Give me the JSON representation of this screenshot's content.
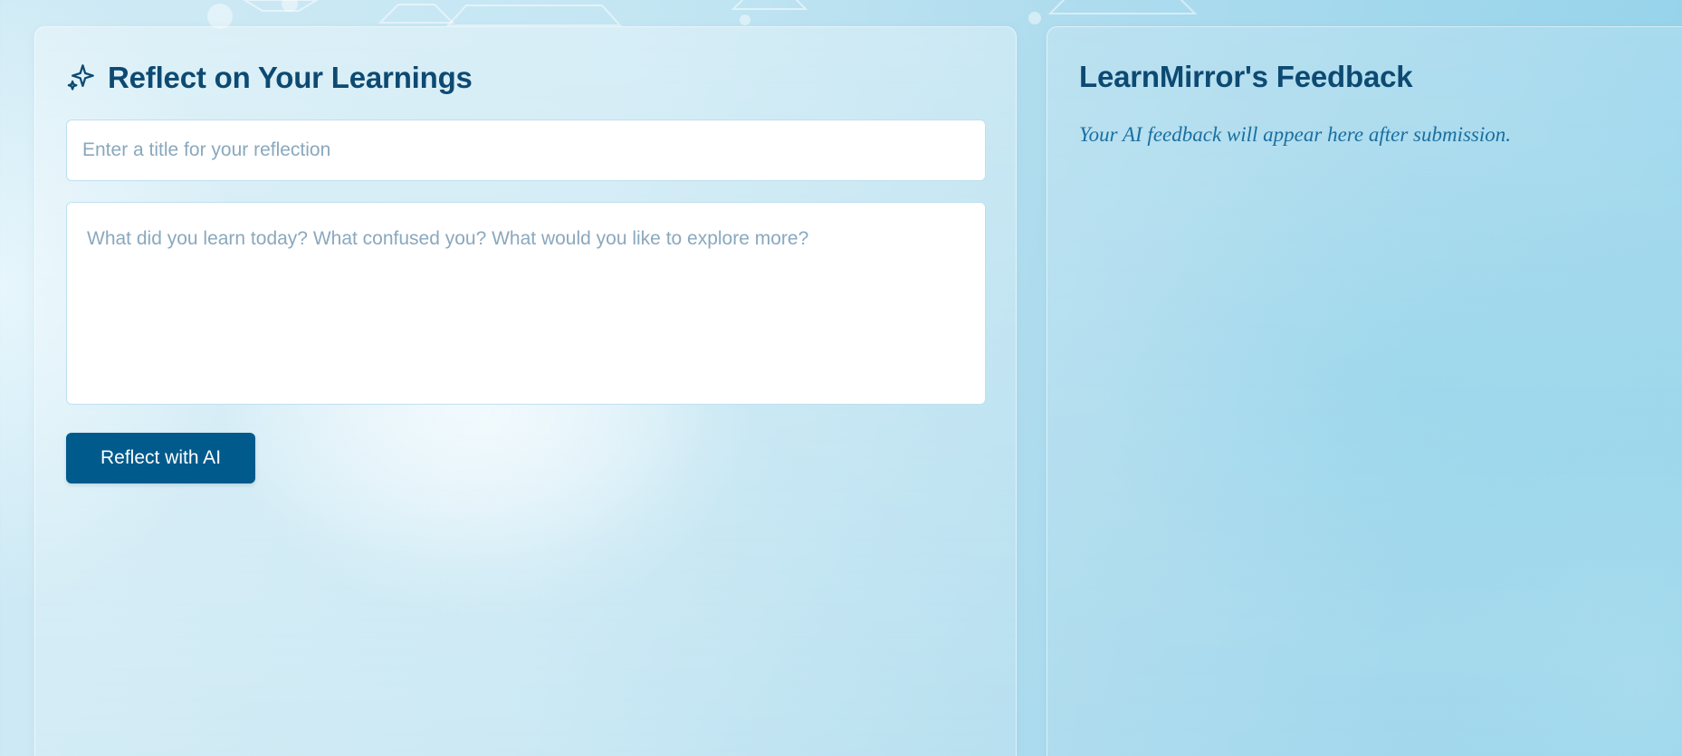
{
  "colors": {
    "heading": "#0d4a72",
    "button_bg": "#005a8c",
    "button_text": "#ffffff",
    "placeholder_text": "#8aa8bd",
    "feedback_text": "#1a6fa0"
  },
  "reflection_panel": {
    "icon": "sparkles-icon",
    "title": "Reflect on Your Learnings",
    "title_input": {
      "value": "",
      "placeholder": "Enter a title for your reflection"
    },
    "reflection_input": {
      "value": "",
      "placeholder": "What did you learn today? What confused you? What would you like to explore more?"
    },
    "submit_label": "Reflect with AI"
  },
  "feedback_panel": {
    "title": "LearnMirror's Feedback",
    "placeholder_text": "Your AI feedback will appear here after submission."
  }
}
